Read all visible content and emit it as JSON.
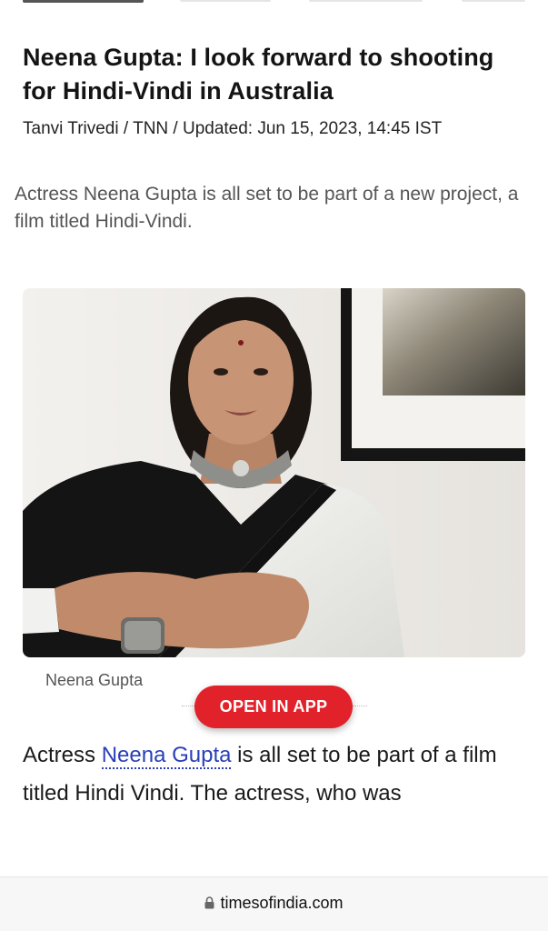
{
  "article": {
    "headline": "Neena Gupta: I look forward to shooting for Hindi-Vindi in Australia",
    "byline": "Tanvi Trivedi / TNN / Updated: Jun 15, 2023, 14:45 IST",
    "summary": "Actress Neena Gupta is all set to be part of a new project, a film titled Hindi-Vindi.",
    "image_caption": "Neena Gupta",
    "body_prefix": "Actress ",
    "body_link": "Neena Gupta",
    "body_suffix": " is all set to be part of a film titled Hindi Vindi. The actress, who was"
  },
  "cta": {
    "open_in_app": "OPEN IN APP"
  },
  "browser": {
    "url": "timesofindia.com",
    "lock_icon": "lock-icon"
  },
  "colors": {
    "cta_red": "#e1222a",
    "link_blue": "#2a3fb8"
  }
}
